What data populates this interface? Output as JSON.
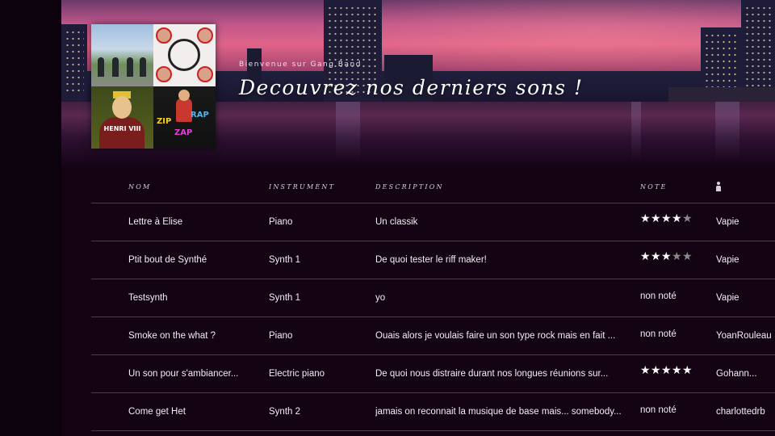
{
  "header": {
    "welcome": "Bienvenue sur Gang Band",
    "headline": "Decouvrez nos derniers sons !",
    "cover_tiles": [
      {
        "icon": "abbey-road-cover"
      },
      {
        "icon": "chili-peppers-cover",
        "text": ""
      },
      {
        "icon": "henri-viii-cover",
        "text": "HENRI VIII"
      },
      {
        "icon": "zip-zap-rap-cover",
        "texts": [
          "ZIP",
          "ZAP",
          "RAP"
        ]
      }
    ]
  },
  "table": {
    "columns": {
      "name": "NOM",
      "instrument": "INSTRUMENT",
      "description": "DESCRIPTION",
      "note": "NOTE",
      "author_icon": "person-icon"
    },
    "rows": [
      {
        "name": "Lettre à Elise",
        "instrument": "Piano",
        "description": "Un classik",
        "rating": 4,
        "note_text": "",
        "author": "Vapie"
      },
      {
        "name": "Ptit bout de Synthé",
        "instrument": "Synth 1",
        "description": "De quoi tester le riff maker!",
        "rating": 3,
        "note_text": "",
        "author": "Vapie"
      },
      {
        "name": "Testsynth",
        "instrument": "Synth 1",
        "description": "yo",
        "rating": null,
        "note_text": "non noté",
        "author": "Vapie"
      },
      {
        "name": "Smoke on the what ?",
        "instrument": "Piano",
        "description": "Ouais alors je voulais faire un son type rock mais en fait ...",
        "rating": null,
        "note_text": "non noté",
        "author": "YoanRouleau"
      },
      {
        "name": "Un son pour s'ambiancer...",
        "instrument": "Electric piano",
        "description": "De quoi nous distraire durant nos longues réunions sur...",
        "rating": 5,
        "note_text": "",
        "author": "Gohann..."
      },
      {
        "name": "Come get Het",
        "instrument": "Synth 2",
        "description": "jamais on reconnait la musique de base mais... somebody...",
        "rating": null,
        "note_text": "non noté",
        "author": "charlottedrb"
      }
    ],
    "rating_max": 5
  },
  "colors": {
    "background": "#130313",
    "row_divider": "#4a3a4c",
    "star_on": "#ffffff",
    "star_off": "#8a8a8a"
  }
}
